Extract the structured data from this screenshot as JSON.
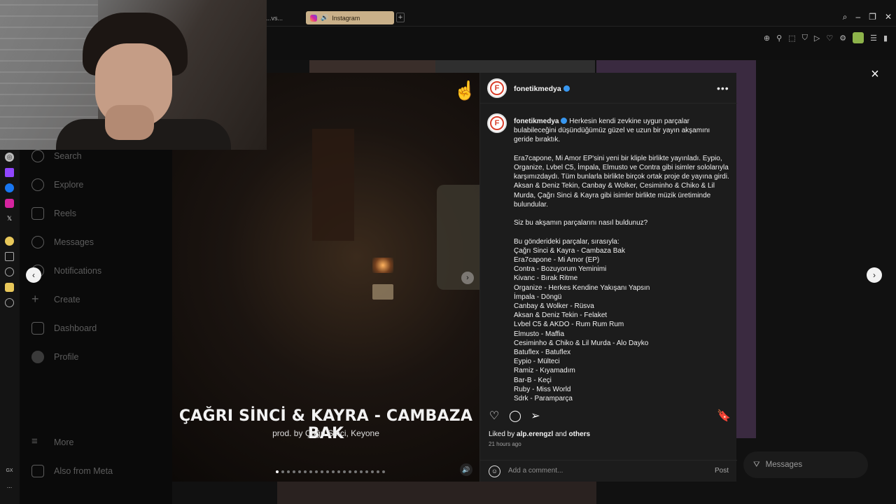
{
  "browser": {
    "prev_tab": "...vs...",
    "active_tab": "Instagram",
    "colors": {
      "active_tab_bg": "#c9b089",
      "extension_accent": "#8db34a"
    }
  },
  "opera_sidebar": {
    "bottom_label": "GX",
    "bottom_more": "..."
  },
  "ig_nav": {
    "items": [
      {
        "label": "Search",
        "icon": "search-icon"
      },
      {
        "label": "Explore",
        "icon": "compass-icon"
      },
      {
        "label": "Reels",
        "icon": "reels-icon"
      },
      {
        "label": "Messages",
        "icon": "messenger-icon"
      },
      {
        "label": "Notifications",
        "icon": "heart-icon"
      },
      {
        "label": "Create",
        "icon": "plus-icon"
      },
      {
        "label": "Dashboard",
        "icon": "dashboard-icon"
      },
      {
        "label": "Profile",
        "icon": "avatar-icon"
      }
    ],
    "more": "More",
    "meta": "Also from Meta"
  },
  "post": {
    "media": {
      "title": "ÇAĞRI SİNCİ & KAYRA - CAMBAZA BAK",
      "subtitle": "prod. by Çağrı Sinci, Keyone",
      "slide_count": 20,
      "current_slide": 1
    },
    "author": "fonetikmedya",
    "avatar_letter": "F",
    "caption_intro": "Herkesin kendi zevkine uygun parçalar bulabileceğini düşündüğümüz güzel ve uzun bir yayın akşamını geride bıraktık.",
    "caption_p2": "Era7capone, Mi Amor EP'sini yeni bir kliple birlikte yayınladı. Eypio, Organize, Lvbel C5, İmpala, Elmusto ve Contra gibi isimler sololarıyla karşımızdaydı. Tüm bunlarla birlikte birçok ortak proje de yayına girdi. Aksan & Deniz Tekin, Canbay & Wolker, Cesiminho & Chiko & Lil Murda, Çağrı Sinci & Kayra gibi isimler birlikte müzik üretiminde bulundular.",
    "caption_question": "Siz bu akşamın parçalarını nasıl buldunuz?",
    "tracklist_header": "Bu gönderideki parçalar, sırasıyla:",
    "tracks": [
      "Çağrı Sinci & Kayra - Cambaza Bak",
      "Era7capone - Mi Amor (EP)",
      "Contra - Bozuyorum Yeminimi",
      "Kivanc - Bırak Ritme",
      "Organize - Herkes Kendine Yakışanı Yapsın",
      "İmpala - Döngü",
      "Canbay & Wolker - Rüsva",
      "Aksan & Deniz Tekin - Felaket",
      "Lvbel C5 & AKDO - Rum Rum Rum",
      "Elmusto - Maffia",
      "Cesiminho & Chiko & Lil Murda - Alo Dayko",
      "Batuflex - Batuflex",
      "Eypio - Mülteci",
      "Ramiz - Kıyamadım",
      "Bar-B - Keçi",
      "Ruby - Miss World",
      "Sdrk - Paramparça"
    ],
    "liked_by_prefix": "Liked by",
    "liked_by_user": "alp.erengzl",
    "liked_and": "and",
    "liked_others": "others",
    "time_ago": "21 hours ago",
    "comment_placeholder": "Add a comment...",
    "post_button": "Post"
  },
  "messages_pill": "Messages",
  "close_icon": "×"
}
